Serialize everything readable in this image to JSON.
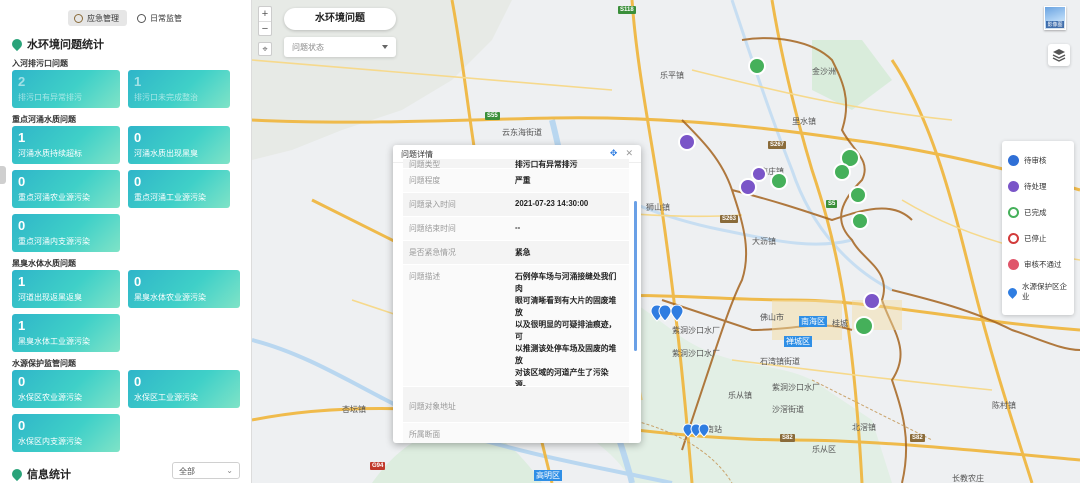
{
  "modes": [
    {
      "label": "应急管理",
      "active": true
    },
    {
      "label": "日常监管",
      "active": false
    }
  ],
  "stats": {
    "title": "水环境问题统计",
    "groups": [
      {
        "title": "入河排污口问题",
        "cards": [
          {
            "value": "2",
            "label": "排污口有异常排污"
          },
          {
            "value": "1",
            "label": "排污口未完成整治"
          }
        ]
      },
      {
        "title": "重点河涌水质问题",
        "cards": [
          {
            "value": "1",
            "label": "河涌水质持续超标"
          },
          {
            "value": "0",
            "label": "河涌水质出现黑臭"
          },
          {
            "value": "0",
            "label": "重点河涌农业源污染"
          },
          {
            "value": "0",
            "label": "重点河涌工业源污染"
          },
          {
            "value": "0",
            "label": "重点河涌内支源污染"
          }
        ]
      },
      {
        "title": "黑臭水体水质问题",
        "cards": [
          {
            "value": "1",
            "label": "河道出现返黑返臭"
          },
          {
            "value": "0",
            "label": "黑臭水体农业源污染"
          },
          {
            "value": "1",
            "label": "黑臭水体工业源污染"
          }
        ]
      },
      {
        "title": "水源保护监管问题",
        "cards": [
          {
            "value": "0",
            "label": "水保区农业源污染"
          },
          {
            "value": "0",
            "label": "水保区工业源污染"
          },
          {
            "value": "0",
            "label": "水保区内支源污染"
          }
        ]
      }
    ]
  },
  "info": {
    "title": "信息统计",
    "select_value": "全部"
  },
  "map": {
    "title": "水环境问题",
    "status_placeholder": "问题状态",
    "basemap_label": "影像图",
    "zoom_in": "+",
    "zoom_out": "−",
    "place_labels": [
      {
        "text": "乐平镇"
      },
      {
        "text": "里水镇"
      },
      {
        "text": "云东海街道"
      },
      {
        "text": "南庄镇"
      },
      {
        "text": "狮山镇"
      },
      {
        "text": "大沥镇"
      },
      {
        "text": "佛山市"
      },
      {
        "text": "桂城"
      },
      {
        "text": "南海区"
      },
      {
        "text": "禅城区"
      },
      {
        "text": "紫洞沙口水厂"
      },
      {
        "text": "石湾镇街道"
      },
      {
        "text": "紫洞沙口水厂"
      },
      {
        "text": "乐从镇"
      },
      {
        "text": "北滘镇"
      },
      {
        "text": "杏坛镇"
      },
      {
        "text": "沙滘街道"
      },
      {
        "text": "紫洞沙口水厂"
      },
      {
        "text": "佛山南站"
      },
      {
        "text": "乐从区"
      },
      {
        "text": "长教农庄"
      },
      {
        "text": "陈村镇"
      },
      {
        "text": "高明区"
      },
      {
        "text": "金沙洲"
      }
    ]
  },
  "legend": [
    {
      "label": "待审核",
      "color": "#2f6fd6"
    },
    {
      "label": "待处理",
      "color": "#7a55c8"
    },
    {
      "label": "已完成",
      "color": "#45b05a"
    },
    {
      "label": "已停止",
      "color": "#d23a3a"
    },
    {
      "label": "审核不通过",
      "color": "#e0556a"
    },
    {
      "label": "水源保护区企业",
      "color": "#2f7de1"
    }
  ],
  "popup": {
    "title": "问题详情",
    "rows": [
      {
        "k": "问题类型",
        "v": "排污口有异常排污"
      },
      {
        "k": "问题程度",
        "v": "严重"
      },
      {
        "k": "问题录入时间",
        "v": "2021-07-23 14:30:00"
      },
      {
        "k": "问题结束时间",
        "v": "--"
      },
      {
        "k": "是否紧急情况",
        "v": "紧急"
      },
      {
        "k": "问题描述",
        "v": "石例停车场与河涌接缝处我们肉\n眼可清晰看到有大片的固废堆放\n以及很明显的可疑排油痕迹，可\n以推测该处停车场及固废的堆放\n对该区域的河道产生了污染源。\n建议相关执法部门，做好跟踪巡\n查该区域的污染源头，核查左侧\n入河排污口是否存在问题，河涌\n右侧的垃圾物堆放及停车场是否"
      },
      {
        "k": "问题对象地址",
        "v": ""
      },
      {
        "k": "所属断面",
        "v": ""
      }
    ]
  }
}
